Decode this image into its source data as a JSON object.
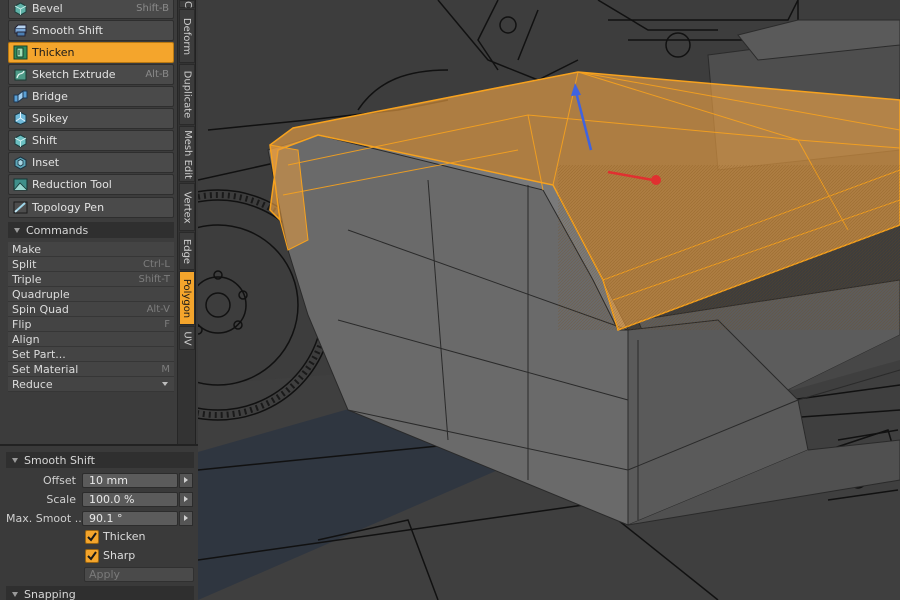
{
  "tools": [
    {
      "id": "bevel",
      "label": "Bevel",
      "shortcut": "Shift-B"
    },
    {
      "id": "smooth-shift",
      "label": "Smooth Shift",
      "shortcut": ""
    },
    {
      "id": "thicken",
      "label": "Thicken",
      "shortcut": "",
      "active": true
    },
    {
      "id": "sketch-extrude",
      "label": "Sketch Extrude",
      "shortcut": "Alt-B"
    },
    {
      "id": "bridge",
      "label": "Bridge",
      "shortcut": ""
    },
    {
      "id": "spikey",
      "label": "Spikey",
      "shortcut": ""
    },
    {
      "id": "shift",
      "label": "Shift",
      "shortcut": ""
    },
    {
      "id": "inset",
      "label": "Inset",
      "shortcut": ""
    },
    {
      "id": "reduction-tool",
      "label": "Reduction Tool",
      "shortcut": ""
    },
    {
      "id": "topology-pen",
      "label": "Topology Pen",
      "shortcut": ""
    }
  ],
  "commands": {
    "header": "Commands",
    "items": [
      {
        "label": "Make",
        "shortcut": ""
      },
      {
        "label": "Split",
        "shortcut": "Ctrl-L"
      },
      {
        "label": "Triple",
        "shortcut": "Shift-T"
      },
      {
        "label": "Quadruple",
        "shortcut": ""
      },
      {
        "label": "Spin Quad",
        "shortcut": "Alt-V"
      },
      {
        "label": "Flip",
        "shortcut": "F"
      },
      {
        "label": "Align",
        "shortcut": ""
      },
      {
        "label": "Set Part...",
        "shortcut": ""
      },
      {
        "label": "Set Material",
        "shortcut": "M"
      },
      {
        "label": "Reduce",
        "shortcut": "",
        "dropdown": true
      }
    ]
  },
  "tabs": [
    {
      "label": "C",
      "active": false
    },
    {
      "label": "Deform",
      "active": false
    },
    {
      "label": "Duplicate",
      "active": false
    },
    {
      "label": "Mesh Edit",
      "active": false
    },
    {
      "label": "Vertex",
      "active": false
    },
    {
      "label": "Edge",
      "active": false
    },
    {
      "label": "Polygon",
      "active": true
    },
    {
      "label": "UV",
      "active": false
    }
  ],
  "properties": {
    "header": "Smooth Shift",
    "offset": {
      "label": "Offset",
      "value": "10 mm"
    },
    "scale": {
      "label": "Scale",
      "value": "100.0 %"
    },
    "max_smooth": {
      "label": "Max. Smoot ...",
      "value": "90.1 °"
    },
    "thicken": {
      "label": "Thicken",
      "checked": true
    },
    "sharp": {
      "label": "Sharp",
      "checked": true
    },
    "apply_label": "Apply"
  },
  "snapping": {
    "header": "Snapping"
  },
  "colors": {
    "accent": "#f4a52c",
    "panel": "#3c3c3c",
    "selection": "#f2a446",
    "gizmo_y": "#3f63e0",
    "gizmo_x": "#e03030"
  }
}
